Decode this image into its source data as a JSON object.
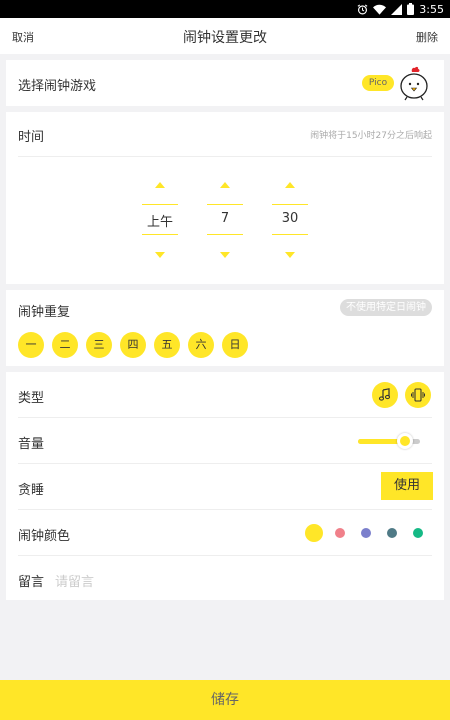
{
  "status_bar": {
    "time": "3:55",
    "icons": [
      "alarm-icon",
      "wifi-icon",
      "signal-icon",
      "battery-icon"
    ]
  },
  "header": {
    "cancel": "取消",
    "title": "闹钟设置更改",
    "delete": "删除"
  },
  "game": {
    "label": "选择闹钟游戏",
    "badge": "Pico"
  },
  "time": {
    "label": "时间",
    "hint": "闹钟将于15小时27分之后响起",
    "period": "上午",
    "hour": "7",
    "minute": "30"
  },
  "repeat": {
    "label": "闹钟重复",
    "no_date_button": "不使用特定日闹钟",
    "days": [
      "一",
      "二",
      "三",
      "四",
      "五",
      "六",
      "日"
    ]
  },
  "settings": {
    "type_label": "类型",
    "type_icons": [
      "music-note-icon",
      "vibrate-icon"
    ],
    "volume_label": "音量",
    "volume_fraction": 0.75,
    "snooze_label": "贪睡",
    "snooze_button": "使用",
    "color_label": "闹钟颜色",
    "colors": [
      "#ffe628",
      "#f0808a",
      "#7b7fcc",
      "#4f7a86",
      "#15b985"
    ],
    "selected_color": "#ffe628",
    "note_label": "留言",
    "note_placeholder": "请留言"
  },
  "footer": {
    "save": "储存"
  },
  "accent": "#ffe628"
}
